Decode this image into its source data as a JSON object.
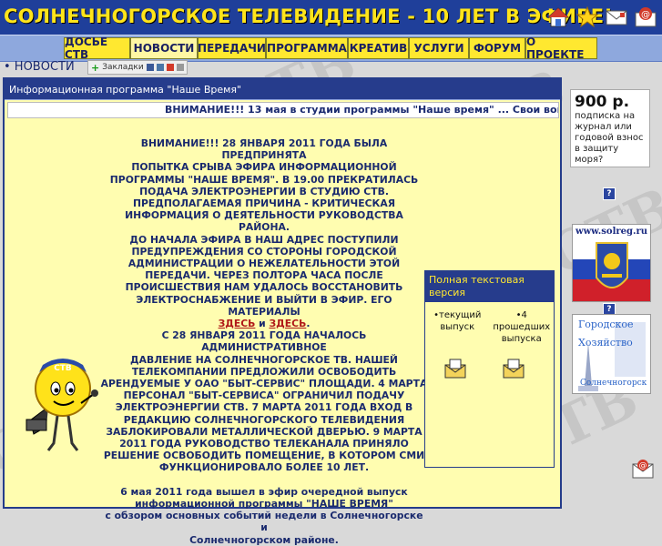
{
  "header": {
    "title": "СОЛНЕЧНОГОРСКОЕ ТЕЛЕВИДЕНИЕ - 10 ЛЕТ В ЭФИРЕ!",
    "icons": [
      "home-icon",
      "star-icon",
      "mail-icon",
      "email-at-icon"
    ]
  },
  "nav": {
    "items": [
      {
        "label": "ДОСЬЕ СТВ",
        "active": false
      },
      {
        "label": "НОВОСТИ",
        "active": true
      },
      {
        "label": "ПЕРЕДАЧИ",
        "active": false
      },
      {
        "label": "ПРОГРАММА",
        "active": false
      },
      {
        "label": "КРЕАТИВ",
        "active": false
      },
      {
        "label": "УСЛУГИ",
        "active": false
      },
      {
        "label": "ФОРУМ",
        "active": false
      },
      {
        "label": "О ПРОЕКТЕ",
        "active": false
      }
    ]
  },
  "section": {
    "title": "• НОВОСТИ",
    "bookmarks_label": "Закладки"
  },
  "main": {
    "header": "Информационная программа \"Наше Время\"",
    "ticker": "ВНИМАНИЕ!!! 13 мая в студии программы \"Наше время\" ... Свои вопро",
    "article_p1_lines": [
      "ВНИМАНИЕ!!! 28 ЯНВАРЯ 2011 ГОДА БЫЛА ПРЕДПРИНЯТА",
      "ПОПЫТКА СРЫВА ЭФИРА ИНФОРМАЦИОННОЙ",
      "ПРОГРАММЫ \"НАШЕ ВРЕМЯ\". В 19.00 ПРЕКРАТИЛАСЬ",
      "ПОДАЧА ЭЛЕКТРОЭНЕРГИИ В СТУДИЮ СТВ.",
      "ПРЕДПОЛАГАЕМАЯ ПРИЧИНА - КРИТИЧЕСКАЯ",
      "ИНФОРМАЦИЯ О ДЕЯТЕЛЬНОСТИ РУКОВОДСТВА РАЙОНА.",
      "ДО НАЧАЛА ЭФИРА В НАШ АДРЕС ПОСТУПИЛИ",
      "ПРЕДУПРЕЖДЕНИЯ СО СТОРОНЫ ГОРОДСКОЙ",
      "АДМИНИСТРАЦИИ О НЕЖЕЛАТЕЛЬНОСТИ ЭТОЙ",
      "ПЕРЕДАЧИ. ЧЕРЕЗ ПОЛТОРА ЧАСА ПОСЛЕ",
      "ПРОИСШЕСТВИЯ НАМ УДАЛОСЬ ВОССТАНОВИТЬ",
      "ЭЛЕКТРОСНАБЖЕНИЕ И ВЫЙТИ В ЭФИР. ЕГО МАТЕРИАЛЫ"
    ],
    "link_here_1": "ЗДЕСЬ",
    "and_word": " и ",
    "link_here_2": "ЗДЕСЬ",
    "period": ".",
    "article_p2_lines": [
      "С 28 ЯНВАРЯ 2011 ГОДА НАЧАЛОСЬ АДМИНИСТРАТИВНОЕ",
      "ДАВЛЕНИЕ НА СОЛНЕЧНОГОРСКОЕ ТВ. НАШЕЙ",
      "ТЕЛЕКОМПАНИИ ПРЕДЛОЖИЛИ ОСВОБОДИТЬ",
      "АРЕНДУЕМЫЕ У ОАО \"БЫТ-СЕРВИС\" ПЛОЩАДИ. 4 МАРТА",
      "ПЕРСОНАЛ \"БЫТ-СЕРВИСА\" ОГРАНИЧИЛ ПОДАЧУ",
      "ЭЛЕКТРОЭНЕРГИИ СТВ. 7 МАРТА 2011 ГОДА ВХОД В",
      "РЕДАКЦИЮ СОЛНЕЧНОГОРСКОГО ТЕЛЕВИДЕНИЯ",
      "ЗАБЛОКИРОВАЛИ МЕТАЛЛИЧЕСКОЙ ДВЕРЬЮ. 9 МАРТА",
      "2011 ГОДА РУКОВОДСТВО ТЕЛЕКАНАЛА ПРИНЯЛО",
      "РЕШЕНИЕ ОСВОБОДИТЬ ПОМЕЩЕНИЕ, В КОТОРОМ СМИ",
      "ФУНКЦИОНИРОВАЛО БОЛЕЕ 10 ЛЕТ."
    ],
    "article_p3_lines": [
      "6 мая 2011 года вышел в эфир очередной выпуск",
      "информационной программы \"НАШЕ ВРЕМЯ\"",
      "с обзором основных событий недели в Солнечногорске и",
      "Солнечногорском районе."
    ]
  },
  "fulltext": {
    "header": "Полная текстовая версия",
    "col1": "•текущий выпуск",
    "col2": "•4 прошедших выпуска"
  },
  "right": {
    "ad_price": "900 р.",
    "ad_text": "подписка на журнал или годовой взнос в защиту моря?",
    "help": "?",
    "solreg_label": "www.solreg.ru",
    "gorod_lines": [
      "Городское",
      "Хозяйство",
      "Солнечногорск"
    ]
  },
  "colors": {
    "header_bg": "#1f3f9a",
    "title_yellow": "#ffe41a",
    "nav_button": "#ffe830",
    "panel_bg": "#fffdb0",
    "text_blue": "#1a2a6e"
  }
}
